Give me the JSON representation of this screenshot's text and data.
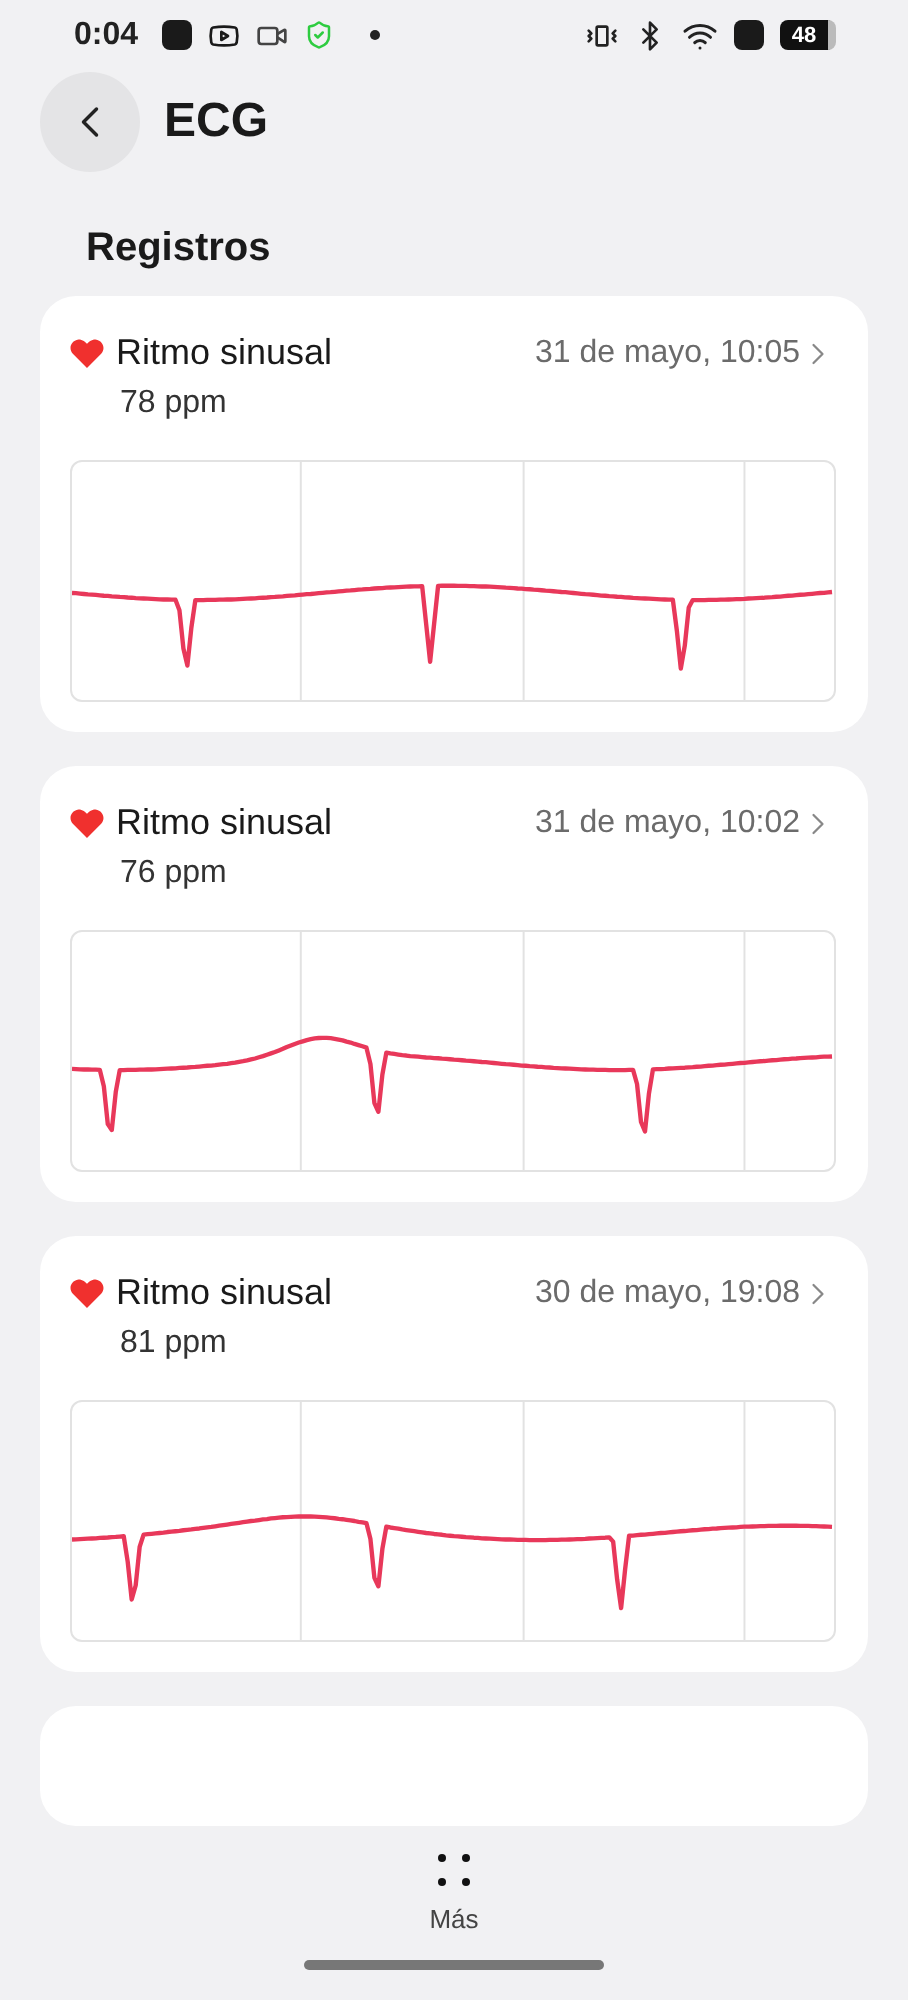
{
  "status_bar": {
    "time": "0:04",
    "battery": "48"
  },
  "header": {
    "title": "ECG"
  },
  "section_title": "Registros",
  "records": [
    {
      "rhythm": "Ritmo sinusal",
      "date": "31 de mayo, 10:05",
      "rate": "78 ppm"
    },
    {
      "rhythm": "Ritmo sinusal",
      "date": "31 de mayo, 10:02",
      "rate": "76 ppm"
    },
    {
      "rhythm": "Ritmo sinusal",
      "date": "30 de mayo, 19:08",
      "rate": "81 ppm"
    }
  ],
  "bottom_bar": {
    "more_label": "Más"
  }
}
